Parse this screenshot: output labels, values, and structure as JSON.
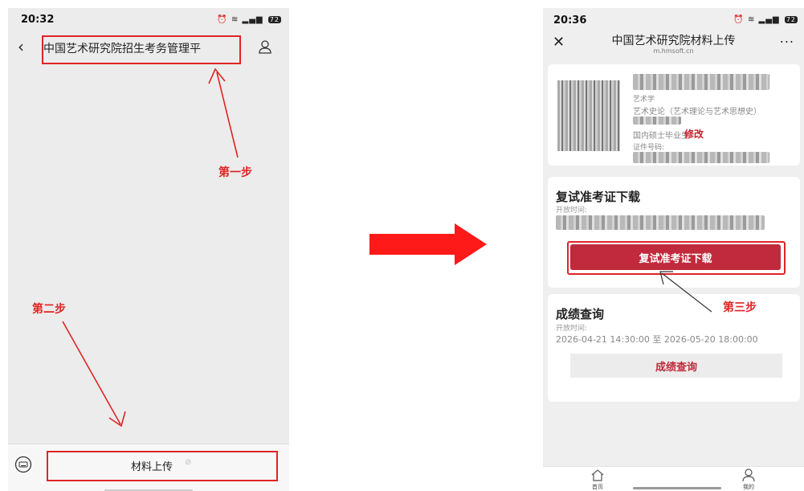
{
  "left_screen": {
    "status": {
      "time": "20:32",
      "battery": "72"
    },
    "nav": {
      "back_icon": "chevron-left-icon",
      "title": "中国艺术研究院招生考务管理平",
      "person_icon": "person-icon"
    },
    "bottom_bar": {
      "keyboard_icon": "keyboard-icon",
      "menu_label": "材料上传"
    },
    "steps": {
      "step1": "第一步",
      "step2": "第二步"
    }
  },
  "right_screen": {
    "status": {
      "time": "20:36",
      "battery": "72"
    },
    "nav": {
      "title": "中国艺术研究院材料上传",
      "subtitle": "m.hmsoft.cn",
      "more": "..."
    },
    "profile": {
      "major": "艺术学",
      "direction": "艺术史论（艺术理论与艺术思想史）",
      "status": "国内硕士毕业生",
      "edit_label": "修改",
      "id_label": "证件号码:"
    },
    "admit_ticket": {
      "title": "复试准考证下载",
      "open_label": "开放时间:",
      "button_label": "复试准考证下载"
    },
    "score_query": {
      "title": "成绩查询",
      "open_label": "开放时间:",
      "time_range": "2026-04-21 14:30:00 至 2026-05-20 18:00:00",
      "button_label": "成绩查询"
    },
    "tabbar": {
      "home_label": "首页",
      "mine_label": "我的"
    },
    "steps": {
      "step3": "第三步"
    }
  },
  "colors": {
    "annotation_red": "#e02424",
    "brand_red": "#c02a3c"
  }
}
